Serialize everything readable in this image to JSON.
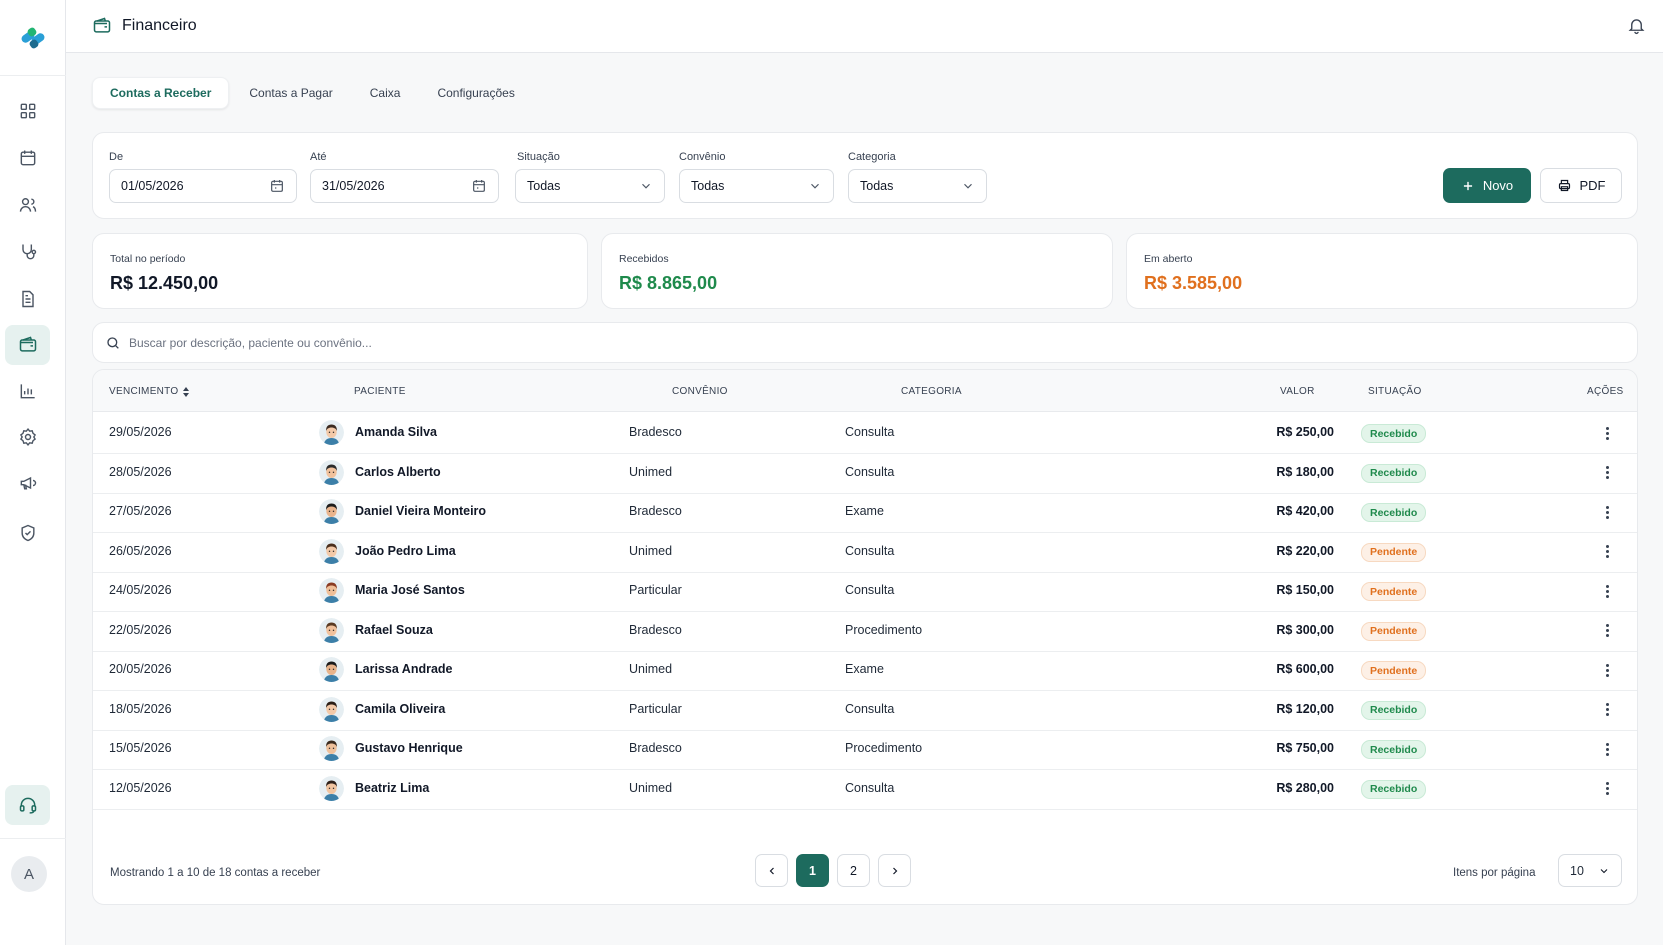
{
  "header": {
    "title": "Financeiro"
  },
  "tabs": [
    {
      "label": "Contas a Receber",
      "active": true
    },
    {
      "label": "Contas a Pagar"
    },
    {
      "label": "Caixa"
    },
    {
      "label": "Configurações"
    }
  ],
  "filters": {
    "de": {
      "label": "De",
      "value": "01/05/2026"
    },
    "ate": {
      "label": "Até",
      "value": "31/05/2026"
    },
    "situacao": {
      "label": "Situação",
      "value": "Todas"
    },
    "convenio": {
      "label": "Convênio",
      "value": "Todas"
    },
    "categoria": {
      "label": "Categoria",
      "value": "Todas"
    },
    "novo_label": "Novo",
    "pdf_label": "PDF"
  },
  "summary": {
    "total": {
      "label": "Total no período",
      "value": "R$ 12.450,00"
    },
    "recebidos": {
      "label": "Recebidos",
      "value": "R$ 8.865,00"
    },
    "aberto": {
      "label": "Em aberto",
      "value": "R$ 3.585,00"
    }
  },
  "search": {
    "placeholder": "Buscar por descrição, paciente ou convênio..."
  },
  "table": {
    "headers": [
      "VENCIMENTO",
      "PACIENTE",
      "CONVÊNIO",
      "CATEGORIA",
      "VALOR",
      "SITUAÇÃO",
      "AÇÕES"
    ],
    "rows": [
      {
        "vencimento": "29/05/2026",
        "paciente": "Amanda Silva",
        "convenio": "Bradesco",
        "categoria": "Consulta",
        "valor": "R$ 250,00",
        "situacao": "Recebido"
      },
      {
        "vencimento": "28/05/2026",
        "paciente": "Carlos Alberto",
        "convenio": "Unimed",
        "categoria": "Consulta",
        "valor": "R$ 180,00",
        "situacao": "Recebido"
      },
      {
        "vencimento": "27/05/2026",
        "paciente": "Daniel Vieira Monteiro",
        "convenio": "Bradesco",
        "categoria": "Exame",
        "valor": "R$ 420,00",
        "situacao": "Recebido"
      },
      {
        "vencimento": "26/05/2026",
        "paciente": "João Pedro Lima",
        "convenio": "Unimed",
        "categoria": "Consulta",
        "valor": "R$ 220,00",
        "situacao": "Pendente"
      },
      {
        "vencimento": "24/05/2026",
        "paciente": "Maria José Santos",
        "convenio": "Particular",
        "categoria": "Consulta",
        "valor": "R$ 150,00",
        "situacao": "Pendente"
      },
      {
        "vencimento": "22/05/2026",
        "paciente": "Rafael Souza",
        "convenio": "Bradesco",
        "categoria": "Procedimento",
        "valor": "R$ 300,00",
        "situacao": "Pendente"
      },
      {
        "vencimento": "20/05/2026",
        "paciente": "Larissa Andrade",
        "convenio": "Unimed",
        "categoria": "Exame",
        "valor": "R$ 600,00",
        "situacao": "Pendente"
      },
      {
        "vencimento": "18/05/2026",
        "paciente": "Camila Oliveira",
        "convenio": "Particular",
        "categoria": "Consulta",
        "valor": "R$ 120,00",
        "situacao": "Recebido"
      },
      {
        "vencimento": "15/05/2026",
        "paciente": "Gustavo Henrique",
        "convenio": "Bradesco",
        "categoria": "Procedimento",
        "valor": "R$ 750,00",
        "situacao": "Recebido"
      },
      {
        "vencimento": "12/05/2026",
        "paciente": "Beatriz Lima",
        "convenio": "Unimed",
        "categoria": "Consulta",
        "valor": "R$ 280,00",
        "situacao": "Recebido"
      }
    ]
  },
  "footer": {
    "showing": "Mostrando 1 a 10 de 18 contas a receber",
    "pages": [
      "1",
      "2"
    ],
    "per_page_label": "Itens por página",
    "per_page_value": "10"
  },
  "user": {
    "initial": "A"
  },
  "colors": {
    "primary": "#1d6b5e",
    "received": "#1f8a4c",
    "open": "#e0701e"
  }
}
